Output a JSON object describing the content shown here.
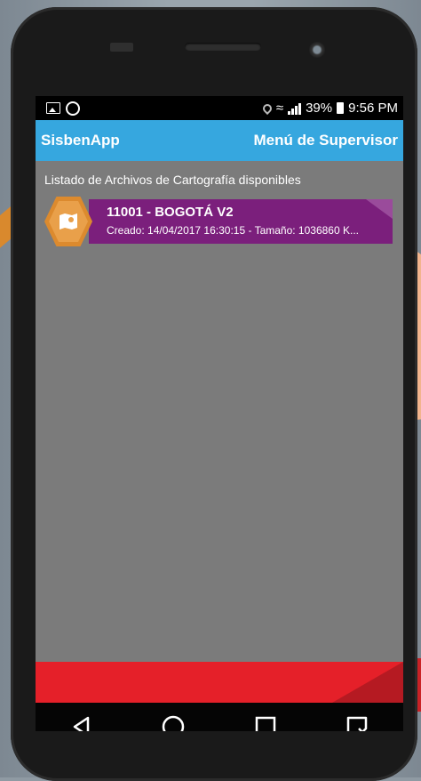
{
  "status_bar": {
    "battery": "39%",
    "time": "9:56 PM"
  },
  "app_bar": {
    "title": "SisbenApp",
    "menu_label": "Menú de Supervisor"
  },
  "list": {
    "heading": "Listado de Archivos de Cartografía disponibles",
    "items": [
      {
        "title": "11001 - BOGOTÁ V2",
        "subtitle": "Creado: 14/04/2017 16:30:15 - Tamaño: 1036860 K..."
      }
    ]
  },
  "colors": {
    "app_bar": "#36a7df",
    "list_item": "#7b1f7c",
    "icon_hex": "#dc8a2e",
    "bottom_bar": "#e52029"
  },
  "icons": {
    "nav_back": "back-triangle-icon",
    "nav_home": "home-circle-icon",
    "nav_recents": "recents-square-icon",
    "nav_extra": "menu-square-icon"
  }
}
